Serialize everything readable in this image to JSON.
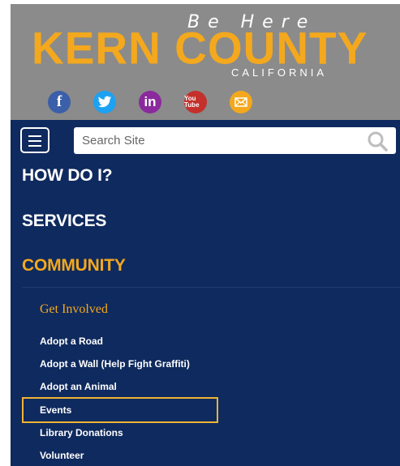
{
  "header": {
    "tagline": "Be Here",
    "brand": "KERN COUNTY",
    "state": "CALIFORNIA",
    "social": [
      {
        "name": "facebook",
        "glyph": "f"
      },
      {
        "name": "twitter",
        "glyph": ""
      },
      {
        "name": "linkedin",
        "glyph": "in"
      },
      {
        "name": "youtube",
        "glyph": "You Tube"
      },
      {
        "name": "email",
        "glyph": ""
      }
    ]
  },
  "search": {
    "placeholder": "Search Site"
  },
  "nav": {
    "items": [
      {
        "label": "HOW DO I?"
      },
      {
        "label": "SERVICES"
      },
      {
        "label": "COMMUNITY"
      }
    ],
    "sub_heading": "Get Involved",
    "links": [
      "Adopt a Road",
      "Adopt a Wall (Help Fight Graffiti)",
      "Adopt an Animal",
      "Events",
      "Library Donations",
      "Volunteer"
    ]
  },
  "colors": {
    "header_bg": "#8b8b8b",
    "nav_bg": "#0f2a5e",
    "accent": "#f4a81d"
  }
}
